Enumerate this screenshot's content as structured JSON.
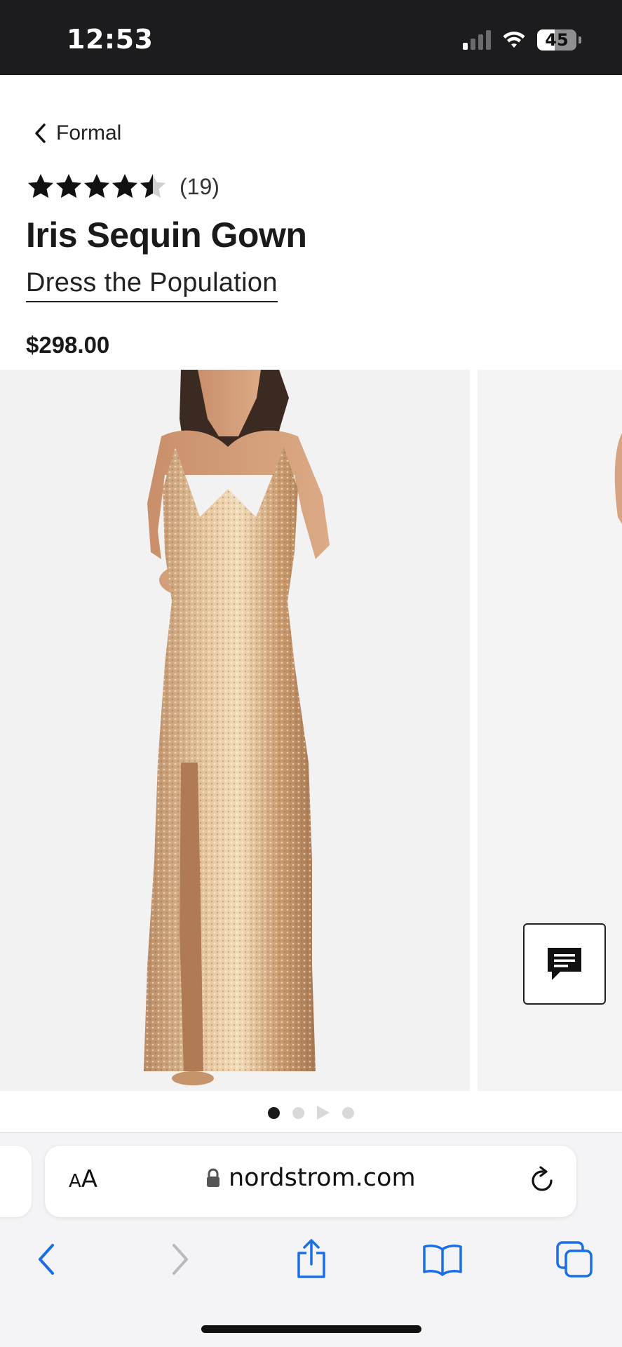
{
  "status_bar": {
    "time": "12:53",
    "battery_level": "45",
    "battery_fraction": 0.45,
    "signal_bars_active": 1,
    "signal_bars_total": 4
  },
  "breadcrumb": {
    "label": "Formal",
    "icon": "chevron-left-icon"
  },
  "product": {
    "rating": 4.5,
    "rating_max": 5,
    "review_count": "(19)",
    "title": "Iris Sequin Gown",
    "brand": "Dress the Population",
    "price": "$298.00"
  },
  "gallery": {
    "image_count": 4,
    "active_index": 0,
    "indicator_types": [
      "dot",
      "dot",
      "video",
      "dot"
    ],
    "background_color": "#f2f2f2"
  },
  "chat": {
    "icon": "chat-bubble-icon"
  },
  "safari": {
    "text_size_label_small": "A",
    "text_size_label_large": "A",
    "url": "nordstrom.com",
    "lock_icon": "lock-icon",
    "reload_icon": "reload-icon",
    "toolbar_icons": [
      "back-icon",
      "forward-icon",
      "share-icon",
      "bookmarks-icon",
      "tabs-icon"
    ],
    "accent_color": "#1a6ee6"
  }
}
